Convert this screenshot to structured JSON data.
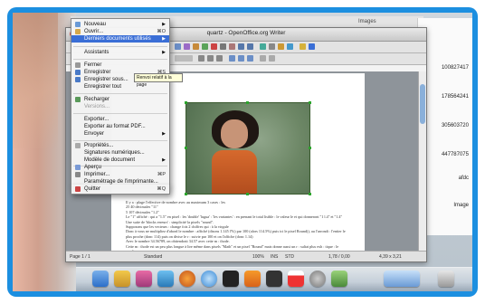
{
  "background_window": {
    "title": "Images"
  },
  "window": {
    "title": "quartz - OpenOffice.org Writer",
    "tooltip": "Renvoi relatif à la page"
  },
  "file_menu": {
    "items": [
      {
        "label": "Nouveau",
        "shortcut": "",
        "submenu": true
      },
      {
        "label": "Ouvrir...",
        "shortcut": "⌘O",
        "submenu": false
      },
      {
        "label": "Derniers documents utilisés",
        "shortcut": "",
        "submenu": true,
        "highlighted": true
      },
      {
        "label": "Assistants",
        "shortcut": "",
        "submenu": true
      },
      {
        "label": "Fermer",
        "shortcut": "",
        "submenu": false
      },
      {
        "label": "Enregistrer",
        "shortcut": "⌘S",
        "submenu": false
      },
      {
        "label": "Enregistrer sous...",
        "shortcut": "",
        "submenu": false
      },
      {
        "label": "Enregistrer tout",
        "shortcut": "",
        "submenu": false
      },
      {
        "label": "Recharger",
        "shortcut": "",
        "submenu": false
      },
      {
        "label": "Versions...",
        "shortcut": "",
        "submenu": false,
        "disabled": true
      },
      {
        "label": "Exporter...",
        "shortcut": "",
        "submenu": false
      },
      {
        "label": "Exporter au format PDF...",
        "shortcut": "",
        "submenu": false
      },
      {
        "label": "Envoyer",
        "shortcut": "",
        "submenu": true
      },
      {
        "label": "Propriétés...",
        "shortcut": "",
        "submenu": false
      },
      {
        "label": "Signatures numériques...",
        "shortcut": "",
        "submenu": false
      },
      {
        "label": "Modèle de document",
        "shortcut": "",
        "submenu": true
      },
      {
        "label": "Aperçu",
        "shortcut": "",
        "submenu": false
      },
      {
        "label": "Imprimer...",
        "shortcut": "⌘P",
        "submenu": false
      },
      {
        "label": "Paramétrage de l'imprimante...",
        "shortcut": "",
        "submenu": false
      },
      {
        "label": "Quitter",
        "shortcut": "⌘Q",
        "submenu": false
      }
    ]
  },
  "document": {
    "lines": [
      "Il y a : plage l'effective de nombre avec au maximum 3 cases : les",
      "25 40 décimales \"11\"",
      "5 107 décimales \"1.2\"",
      "Le \"1\" affiché : qui a \"1.5\" en pixel : les 'double' 'lugua' : 'les variantes' : en prenant le total lisible : le valeur le et qui donneront \"1 l.4\" et \"1.4\"",
      "",
      "Une suite de 'blocks erreurs' : simplicité la pixels \"round\".",
      "Supposons que les vecteurs : change fois 2 chiffres qui : à la virgule",
      "Donc à vous ne multipliez d'abord le nombre : affiché (disons 1.145 l'%) par 100 (alors 114.5%) puis ici le pixel Round(), au l'arrondi : l'entier le",
      "plus proche (donc 114) puis on divise le r : suivie par 100 et on l'affiche (donc 1.14)",
      "Avec le nombre 34.56789, on obtiendrait 34.57 avec cette m : thode.",
      "Cette m : thode est un peu plus longue à lire même dans pixels \"Math\" et un pixel \"Round\" mais donne aussi un r : sultat plus exh : tique : le nombre",
      "de chiffres apr : s la virgule est constant."
    ]
  },
  "status_bar": {
    "page": "Page 1 / 1",
    "style": "Standard",
    "zoom": "100%",
    "mode": "INS",
    "std": "STD",
    "position": "1,78 / 0,00",
    "size": "4,39 x 3,21"
  },
  "right_panel": {
    "items": [
      "100827417",
      "178564241",
      "305603720",
      "447787075",
      "afdc",
      "Image"
    ]
  },
  "dock": {
    "icons": [
      "finder-icon",
      "mail-icon",
      "photos-icon",
      "itunes-icon",
      "firefox-icon",
      "safari-icon",
      "terminal-icon",
      "vlc-icon",
      "dvd-icon",
      "calendar-icon",
      "gear-icon",
      "iphoto-icon",
      "folder-icon",
      "trash-icon"
    ]
  }
}
